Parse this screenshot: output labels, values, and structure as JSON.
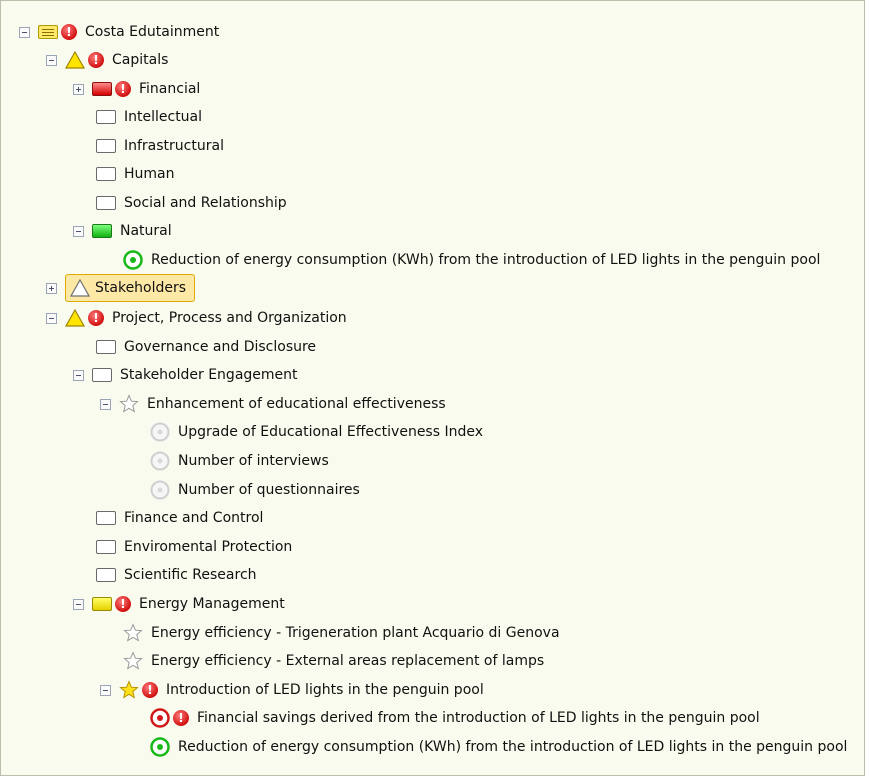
{
  "tree": {
    "root": "Costa Edutainment",
    "capitals": "Capitals",
    "financial": "Financial",
    "intellectual": "Intellectual",
    "infrastructural": "Infrastructural",
    "human": "Human",
    "social": "Social and Relationship",
    "natural": "Natural",
    "natural_goal": "Reduction of energy consumption (KWh) from the introduction of LED lights in the penguin pool",
    "stakeholders": "Stakeholders",
    "ppo": "Project, Process and Organization",
    "governance": "Governance and Disclosure",
    "engagement": "Stakeholder Engagement",
    "enhancement": "Enhancement of educational effectiveness",
    "upgrade": "Upgrade of Educational Effectiveness Index",
    "interviews": "Number of interviews",
    "questionnaires": "Number of questionnaires",
    "finance_control": "Finance and Control",
    "env_protection": "Enviromental Protection",
    "scientific": "Scientific Research",
    "energy_mgmt": "Energy Management",
    "trigeneration": "Energy efficiency - Trigeneration plant Acquario di Genova",
    "external_lamps": "Energy efficiency - External areas replacement of lamps",
    "led_intro": "Introduction of LED lights in the penguin pool",
    "financial_savings": "Financial savings derived from the introduction of LED lights in the penguin pool",
    "energy_reduction": "Reduction of energy consumption (KWh) from the introduction of LED lights in the penguin pool"
  },
  "icons": {
    "warning": "warning-triangle-icon",
    "error": "error-exclamation-icon",
    "star": "star-icon",
    "target": "target-icon"
  },
  "colors": {
    "red": "#d30000",
    "green": "#12b012",
    "yellow": "#e6d000",
    "selected": "#fde8a6"
  }
}
